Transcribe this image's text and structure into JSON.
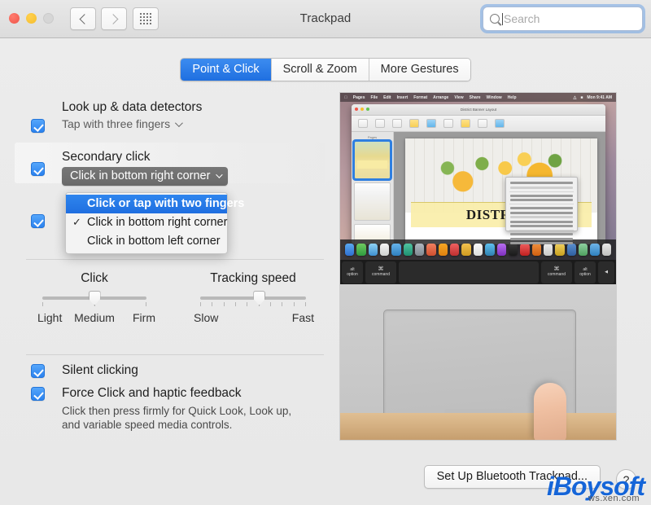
{
  "window": {
    "title": "Trackpad",
    "traffic": {
      "close": "close-button",
      "minimize": "minimize-button",
      "zoom": "zoom-button"
    },
    "nav": {
      "back": "‹",
      "forward": "›",
      "grid": "show-all-icon"
    }
  },
  "search": {
    "placeholder": "Search",
    "value": ""
  },
  "tabs": [
    {
      "label": "Point & Click",
      "active": true
    },
    {
      "label": "Scroll & Zoom",
      "active": false
    },
    {
      "label": "More Gestures",
      "active": false
    }
  ],
  "options": {
    "lookup": {
      "label": "Look up & data detectors",
      "value": "Tap with three fingers",
      "checked": true
    },
    "secondary": {
      "label": "Secondary click",
      "value": "Click in bottom right corner",
      "checked": true,
      "menu_open": true,
      "menu_items": [
        {
          "label": "Click or tap with two fingers",
          "selected": true,
          "checked": false
        },
        {
          "label": "Click in bottom right corner",
          "selected": false,
          "checked": true
        },
        {
          "label": "Click in bottom left corner",
          "selected": false,
          "checked": false
        }
      ]
    },
    "third_hidden": {
      "checked": true
    },
    "silent": {
      "label": "Silent clicking",
      "checked": true
    },
    "force": {
      "label": "Force Click and haptic feedback",
      "checked": true,
      "help_line1": "Click then press firmly for Quick Look, Look up,",
      "help_line2": "and variable speed media controls."
    }
  },
  "sliders": {
    "click": {
      "title": "Click",
      "left": "Light",
      "middle": "Medium",
      "right": "Firm",
      "ticks": 3,
      "position_percent": 50
    },
    "tracking": {
      "title": "Tracking speed",
      "left": "Slow",
      "right": "Fast",
      "ticks": 10,
      "position_percent": 56
    }
  },
  "preview": {
    "app_menu": [
      "Pages",
      "File",
      "Edit",
      "Insert",
      "Format",
      "Arrange",
      "View",
      "Share",
      "Window",
      "Help"
    ],
    "doc_title": "District Banner Layout",
    "doc_heading": "DISTRICT",
    "sidebar_label": "Pages"
  },
  "footer": {
    "bluetooth_label": "Set Up Bluetooth Trackpad...",
    "help_label": "?"
  },
  "watermark": {
    "brand": "iBoysoft",
    "sub": "ws.xen.com"
  },
  "colors": {
    "accent": "#2b82ef",
    "tab_active": "#1f6fe0",
    "menu_highlight": "#2f86ee",
    "popup_button": "#6f6f6f",
    "watermark": "#1565d8"
  }
}
